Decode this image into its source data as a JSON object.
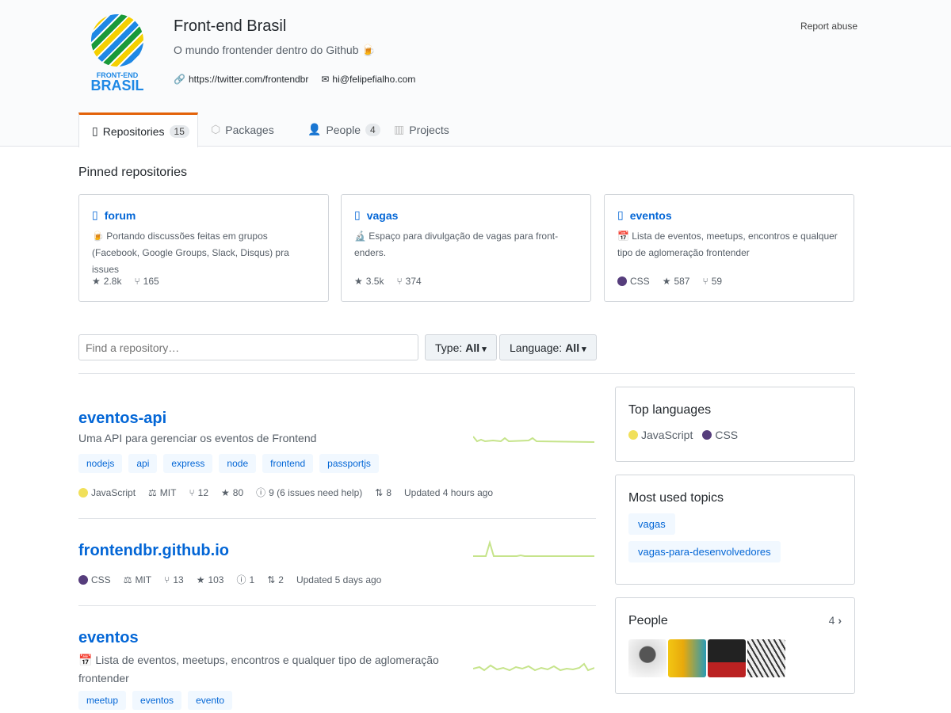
{
  "org": {
    "name": "Front-end Brasil",
    "description": "O mundo frontender dentro do Github",
    "twitter": "https://twitter.com/frontendbr",
    "email": "hi@felipefialho.com",
    "report_abuse": "Report abuse",
    "logo_text": [
      "FRONT-END",
      "BRASIL"
    ]
  },
  "tabs": [
    {
      "label": "Repositories",
      "count": "15"
    },
    {
      "label": "Packages"
    },
    {
      "label": "People",
      "count": "4"
    },
    {
      "label": "Projects"
    }
  ],
  "pinned": {
    "heading": "Pinned repositories",
    "cards": [
      {
        "name": "forum",
        "description": "Portando discussões feitas em grupos (Facebook, Google Groups, Slack, Disqus) pra issues",
        "stars": "2.8k",
        "forks": "165"
      },
      {
        "name": "vagas",
        "description": "Espaço para divulgação de vagas para front-enders.",
        "stars": "3.5k",
        "forks": "374"
      },
      {
        "name": "eventos",
        "description": "Lista de eventos, meetups, encontros e qualquer tipo de aglomeração frontender",
        "language": "CSS",
        "stars": "587",
        "forks": "59"
      }
    ]
  },
  "filters": {
    "search_placeholder": "Find a repository…",
    "type_label": "Type:",
    "type_value": "All",
    "language_label": "Language:",
    "language_value": "All"
  },
  "repos": [
    {
      "name": "eventos-api",
      "description": "Uma API para gerenciar os eventos de Frontend",
      "topics": [
        "nodejs",
        "api",
        "express",
        "node",
        "frontend",
        "passportjs"
      ],
      "language": "JavaScript",
      "license": "MIT",
      "forks": "12",
      "stars": "80",
      "issues": "9 (6 issues need help)",
      "prs": "8",
      "updated": "Updated 4 hours ago"
    },
    {
      "name": "frontendbr.github.io",
      "language": "CSS",
      "license": "MIT",
      "forks": "13",
      "stars": "103",
      "issues": "1",
      "prs": "2",
      "updated": "Updated 5 days ago"
    },
    {
      "name": "eventos",
      "description": "Lista de eventos, meetups, encontros e qualquer tipo de aglomeração frontender",
      "topics": [
        "meetup",
        "eventos",
        "evento"
      ]
    }
  ],
  "sidebar": {
    "top_languages": {
      "title": "Top languages",
      "items": [
        "JavaScript",
        "CSS"
      ]
    },
    "topics": {
      "title": "Most used topics",
      "items": [
        "vagas",
        "vagas-para-desenvolvedores"
      ]
    },
    "people": {
      "title": "People",
      "count": "4"
    }
  },
  "colors": {
    "javascript": "#f1e05a",
    "css": "#563d7c",
    "accent": "#0366d6",
    "tab_active": "#e36209"
  }
}
